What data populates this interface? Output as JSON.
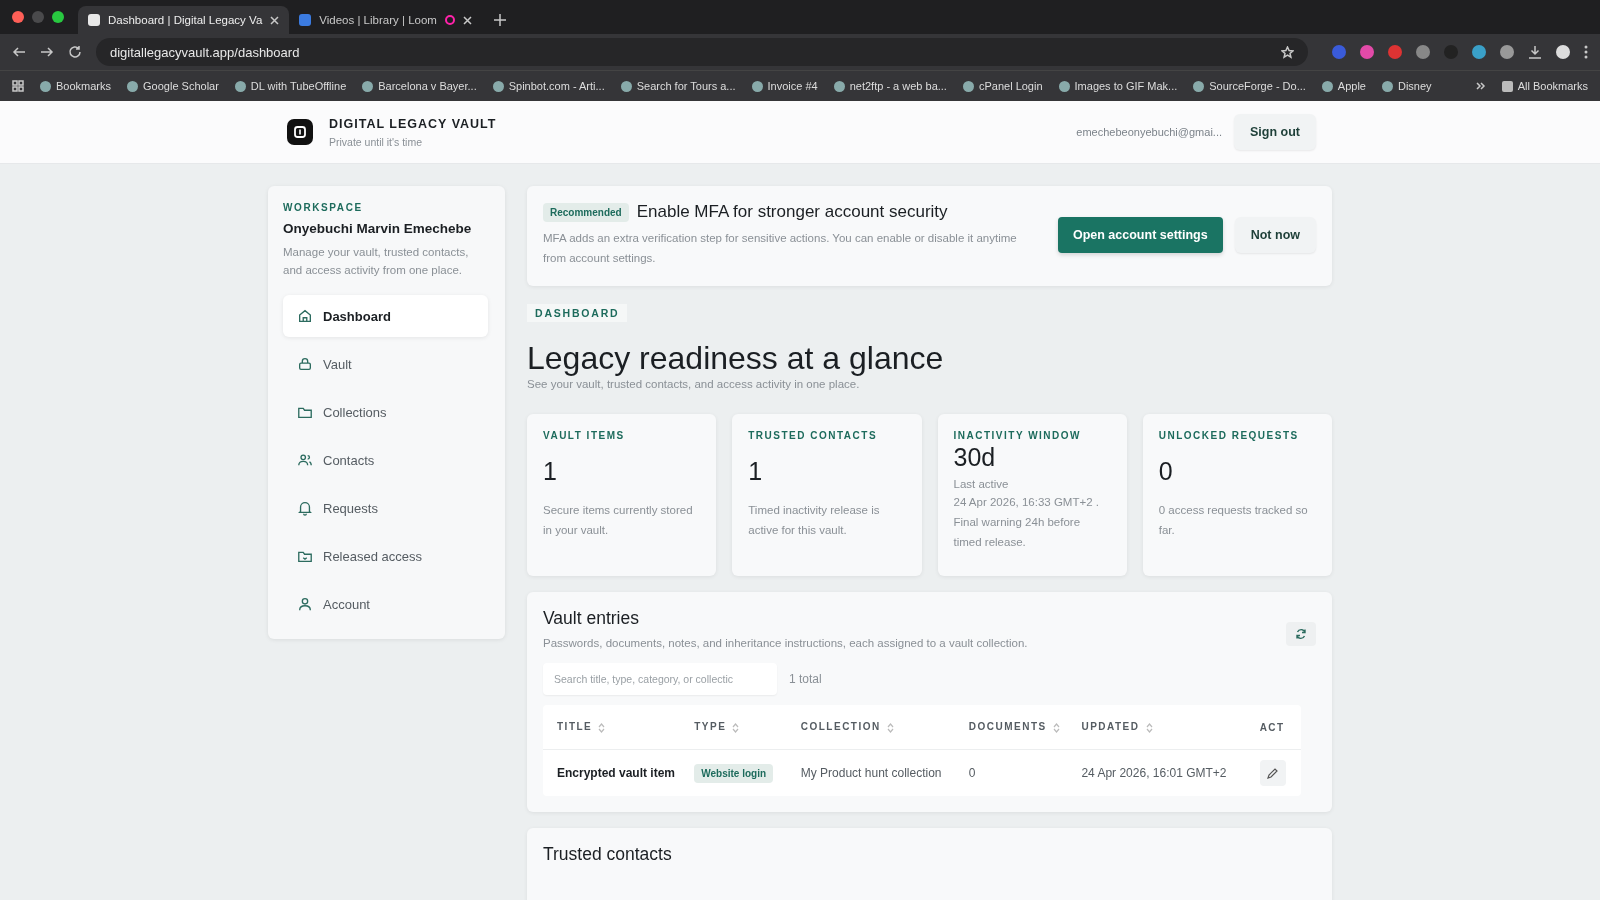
{
  "browser": {
    "tabs": [
      {
        "title": "Dashboard | Digital Legacy Va",
        "selected": true
      },
      {
        "title": "Videos | Library | Loom",
        "selected": false
      }
    ],
    "url": "digitallegacyvault.app/dashboard",
    "bookmarks": [
      "Bookmarks",
      "Google Scholar",
      "DL with TubeOffline",
      "Barcelona v Bayer...",
      "Spinbot.com - Arti...",
      "Search for Tours a...",
      "Invoice #4",
      "net2ftp - a web ba...",
      "cPanel Login",
      "Images to GIF Mak...",
      "SourceForge - Do...",
      "Apple",
      "Disney"
    ],
    "all_bookmarks": "All Bookmarks"
  },
  "header": {
    "brand": "DIGITAL LEGACY VAULT",
    "tagline": "Private until it's time",
    "email": "emechebeonyebuchi@gmai...",
    "sign_out": "Sign out"
  },
  "sidebar": {
    "eyebrow": "WORKSPACE",
    "name": "Onyebuchi Marvin Emechebe",
    "description": "Manage your vault, trusted contacts, and access activity from one place.",
    "items": [
      {
        "label": "Dashboard",
        "selected": true
      },
      {
        "label": "Vault",
        "selected": false
      },
      {
        "label": "Collections",
        "selected": false
      },
      {
        "label": "Contacts",
        "selected": false
      },
      {
        "label": "Requests",
        "selected": false
      },
      {
        "label": "Released access",
        "selected": false
      },
      {
        "label": "Account",
        "selected": false
      }
    ]
  },
  "banner": {
    "badge": "Recommended",
    "title": "Enable MFA for stronger account security",
    "text": "MFA adds an extra verification step for sensitive actions. You can enable or disable it anytime from account settings.",
    "primary": "Open account settings",
    "secondary": "Not now"
  },
  "page": {
    "eyebrow": "DASHBOARD",
    "title": "Legacy readiness at a glance",
    "subtitle": "See your vault, trusted contacts, and access activity in one place."
  },
  "stats": [
    {
      "label": "VAULT ITEMS",
      "value": "1",
      "note": "Secure items currently stored in your vault."
    },
    {
      "label": "TRUSTED CONTACTS",
      "value": "1",
      "note": "Timed inactivity release is active for this vault."
    },
    {
      "label": "INACTIVITY WINDOW",
      "value": "30d",
      "sub": "Last active",
      "note": "24 Apr 2026, 16:33 GMT+2 . Final warning 24h before timed release."
    },
    {
      "label": "UNLOCKED REQUESTS",
      "value": "0",
      "note": "0 access requests tracked so far."
    }
  ],
  "vault": {
    "title": "Vault entries",
    "subtitle": "Passwords, documents, notes, and inheritance instructions, each assigned to a vault collection.",
    "search_placeholder": "Search title, type, category, or collectic",
    "count": "1 total",
    "columns": [
      "TITLE",
      "TYPE",
      "COLLECTION",
      "DOCUMENTS",
      "UPDATED",
      "ACT"
    ],
    "rows": [
      {
        "title": "Encrypted vault item",
        "type": "Website login",
        "collection": "My Product hunt collection",
        "documents": "0",
        "updated": "24 Apr 2026, 16:01 GMT+2"
      }
    ]
  },
  "contacts": {
    "title": "Trusted contacts"
  }
}
